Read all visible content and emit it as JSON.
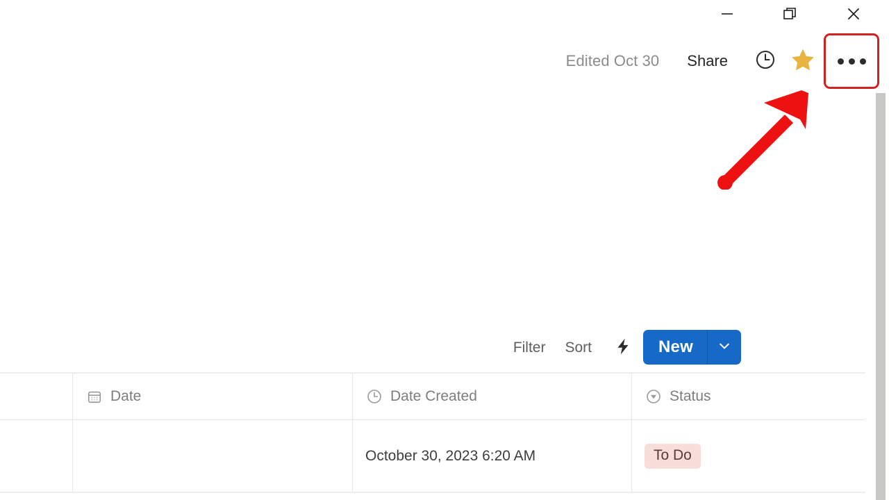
{
  "window_controls": {
    "minimize": {
      "name": "minimize",
      "label": "Minimize"
    },
    "restore": {
      "name": "restore",
      "label": "Restore Down"
    },
    "close": {
      "name": "close",
      "label": "Close"
    }
  },
  "topbar": {
    "edited_label": "Edited Oct 30",
    "share_label": "Share",
    "history_icon": "clock-icon",
    "favorite_icon": "star-icon",
    "more_icon": "ellipsis-icon",
    "highlight_color": "#d32020"
  },
  "annotation": {
    "type": "arrow",
    "color": "#ee1111",
    "points_to": "more-menu-button"
  },
  "toolbar": {
    "filter_label": "Filter",
    "sort_label": "Sort",
    "automation_icon": "lightning-bolt-icon",
    "search_icon": "search-icon",
    "more_icon": "ellipsis-icon",
    "new_label": "New",
    "new_dropdown_icon": "chevron-down-icon",
    "new_button_color": "#1769c8"
  },
  "table": {
    "columns": [
      {
        "label": "",
        "icon": ""
      },
      {
        "label": "Date",
        "icon": "calendar-icon"
      },
      {
        "label": "Date Created",
        "icon": "clock-icon"
      },
      {
        "label": "Status",
        "icon": "select-circle-icon"
      }
    ],
    "rows": [
      {
        "gutter": "",
        "date": "",
        "date_created": "October 30, 2023 6:20 AM",
        "status": "To Do",
        "status_bg": "#f8dedb",
        "status_fg": "#5b3a36"
      }
    ]
  },
  "scrollbar": {
    "orientation": "vertical",
    "color": "#c8c8c6"
  }
}
